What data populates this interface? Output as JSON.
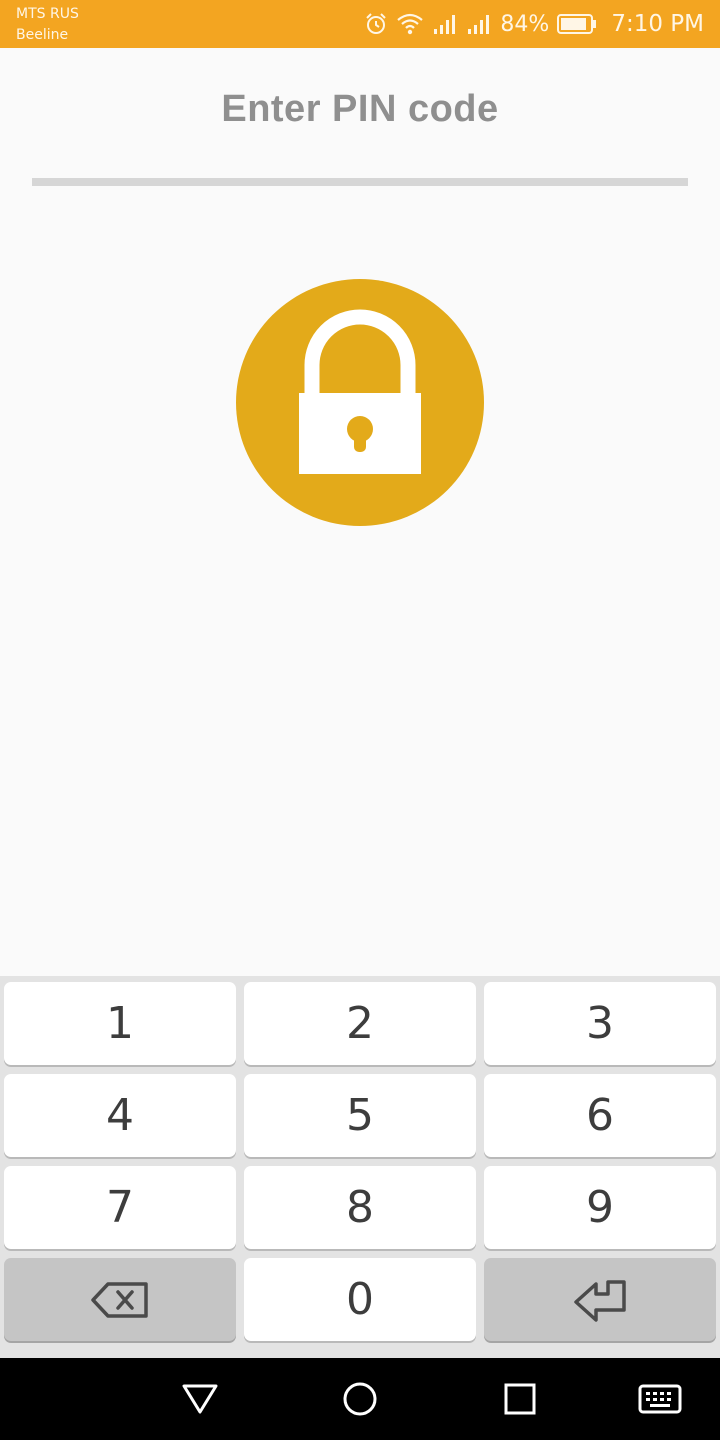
{
  "status_bar": {
    "carrier_1": "MTS RUS",
    "carrier_2": "Beeline",
    "battery": "84%",
    "time": "7:10 PM",
    "color": "#f3a521"
  },
  "header": {
    "title": "Enter PIN code"
  },
  "lock": {
    "icon": "lock-icon",
    "color": "#e3aa1a"
  },
  "keypad": {
    "keys": [
      "1",
      "2",
      "3",
      "4",
      "5",
      "6",
      "7",
      "8",
      "9",
      "0"
    ],
    "backspace_icon": "backspace-icon",
    "enter_icon": "enter-icon"
  },
  "nav_bar": {
    "icons": [
      "back-icon",
      "home-icon",
      "recents-icon",
      "keyboard-icon"
    ]
  }
}
